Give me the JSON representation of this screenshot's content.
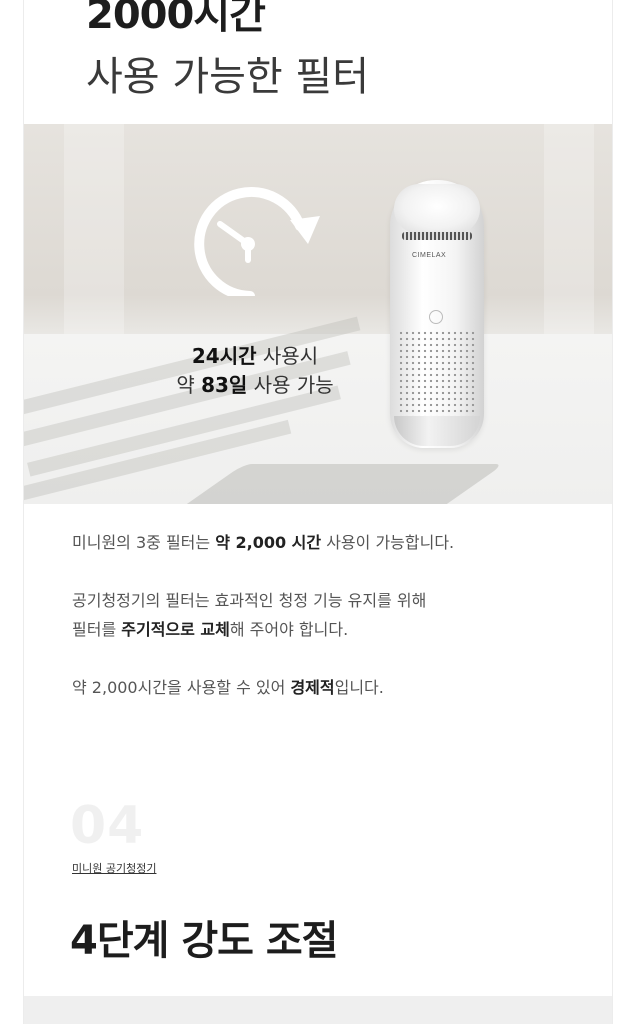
{
  "hero": {
    "title_bold": "2000시간",
    "title_light": "사용 가능한 필터"
  },
  "photo": {
    "icon": "clock-rotate-icon",
    "brand_logo": "CIMELAX",
    "caption_line1_bold": "24시간",
    "caption_line1_rest": " 사용시",
    "caption_line2_pre": "약 ",
    "caption_line2_bold": "83일",
    "caption_line2_rest": " 사용 가능"
  },
  "description": {
    "p1_pre": "미니원의 3중 필터는 ",
    "p1_bold": "약 2,000 시간",
    "p1_post": " 사용이 가능합니다.",
    "p2_line1": "공기청정기의 필터는 효과적인 청정 기능 유지를 위해",
    "p2_line2_pre": "필터를 ",
    "p2_line2_bold": "주기적으로 교체",
    "p2_line2_post": "해 주어야 합니다.",
    "p3_pre": "약 2,000시간을 사용할 수 있어 ",
    "p3_bold": "경제적",
    "p3_post": "입니다."
  },
  "section": {
    "number": "04",
    "subtitle": "미니원 공기청정기",
    "title": "4단계 강도 조절"
  },
  "colors": {
    "text_dark": "#1d1d1d",
    "text_body": "#555555",
    "section_number": "#f0f0f0",
    "panel": "#efefef"
  }
}
